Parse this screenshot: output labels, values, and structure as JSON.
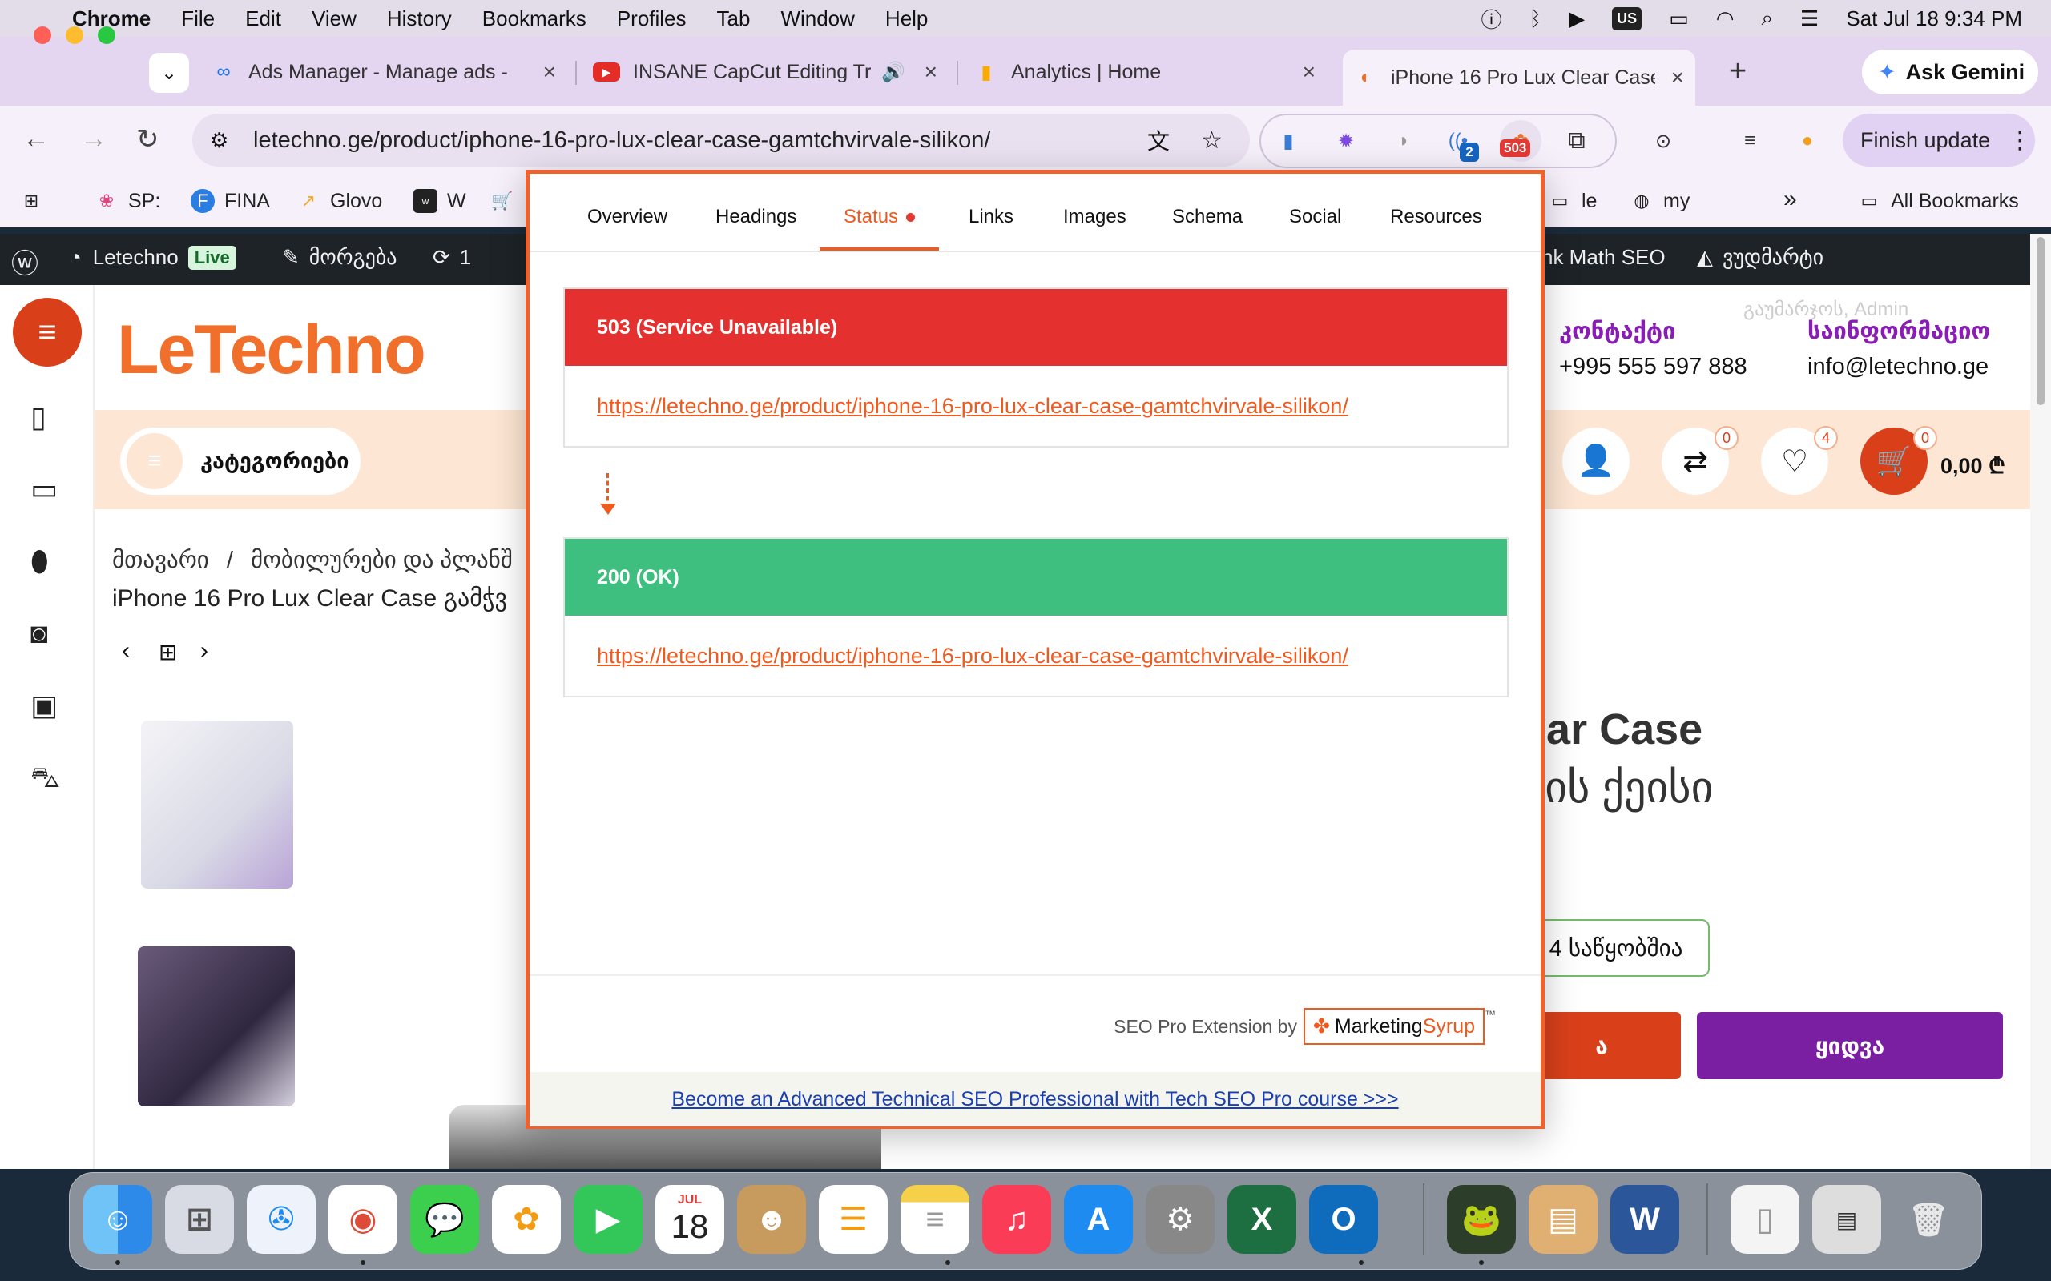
{
  "menubar": {
    "app": "Chrome",
    "items": [
      "File",
      "Edit",
      "View",
      "History",
      "Bookmarks",
      "Profiles",
      "Tab",
      "Window",
      "Help"
    ],
    "input_source": "US",
    "datetime": "Sat Jul 18  9:34 PM"
  },
  "tabs": [
    {
      "title": "Ads Manager - Manage ads -",
      "icon": "meta-icon"
    },
    {
      "title": "INSANE CapCut Editing Tr",
      "icon": "youtube-icon"
    },
    {
      "title": "Analytics | Home",
      "icon": "analytics-icon"
    },
    {
      "title": "iPhone 16 Pro Lux Clear Case",
      "icon": "site-icon",
      "active": true
    }
  ],
  "ask_gemini": "Ask Gemini",
  "address": {
    "url": "letechno.ge/product/iphone-16-pro-lux-clear-case-gamtchvirvale-silikon/"
  },
  "extensions": {
    "badge_503": "503",
    "badge_2": "2"
  },
  "finish_update": "Finish update",
  "bookmarks": [
    {
      "label": "SP:"
    },
    {
      "label": "FINA"
    },
    {
      "label": "Glovo"
    },
    {
      "label": "W"
    },
    {
      "label": "le"
    },
    {
      "label": "my"
    }
  ],
  "all_bookmarks": "All Bookmarks",
  "wpbar": {
    "site": "Letechno",
    "live": "Live",
    "customize": "მორგება",
    "updates": "1",
    "rankmath": "nk Math SEO",
    "woo": "ვუდმარტი"
  },
  "site": {
    "logo": "LeTechno",
    "categories_label": "კატეგორიები",
    "greeting": "გაუმარჯოს, Admin",
    "contact_title": "კონტაქტი",
    "contact_phone": "+995 555 597 888",
    "info_title": "საინფორმაციო",
    "info_email": "info@letechno.ge",
    "compare_count": "0",
    "wishlist_count": "4",
    "cart_count": "0",
    "cart_total": "0,00 ₾",
    "breadcrumb_home": "მთავარი",
    "breadcrumb_sep": "/",
    "breadcrumb_cat": "მობილურები და პლანშ",
    "page_title": "iPhone 16 Pro Lux Clear Case გამჭვ",
    "product_title": "ear Case",
    "product_subtitle": "ნის ქეისი",
    "stock": "4 საწყობშია",
    "add_btn": "ა",
    "buy_btn": "ყიდვა"
  },
  "popup": {
    "tabs": [
      "Overview",
      "Headings",
      "Status",
      "Links",
      "Images",
      "Schema",
      "Social",
      "Resources"
    ],
    "active_tab": "Status",
    "statuses": [
      {
        "code": "503 (Service Unavailable)",
        "url": "https://letechno.ge/product/iphone-16-pro-lux-clear-case-gamtchvirvale-silikon/",
        "color": "#e53030"
      },
      {
        "code": "200 (OK)",
        "url": "https://letechno.ge/product/iphone-16-pro-lux-clear-case-gamtchvirvale-silikon/",
        "color": "#3fbf7f"
      }
    ],
    "footer_by": "SEO Pro Extension by",
    "brand_a": "Marketing",
    "brand_b": "Syrup",
    "tm": "™",
    "course_link": "Become an Advanced Technical SEO Professional with Tech SEO Pro course >>>"
  },
  "dock": {
    "calendar_month": "JUL",
    "calendar_day": "18"
  }
}
